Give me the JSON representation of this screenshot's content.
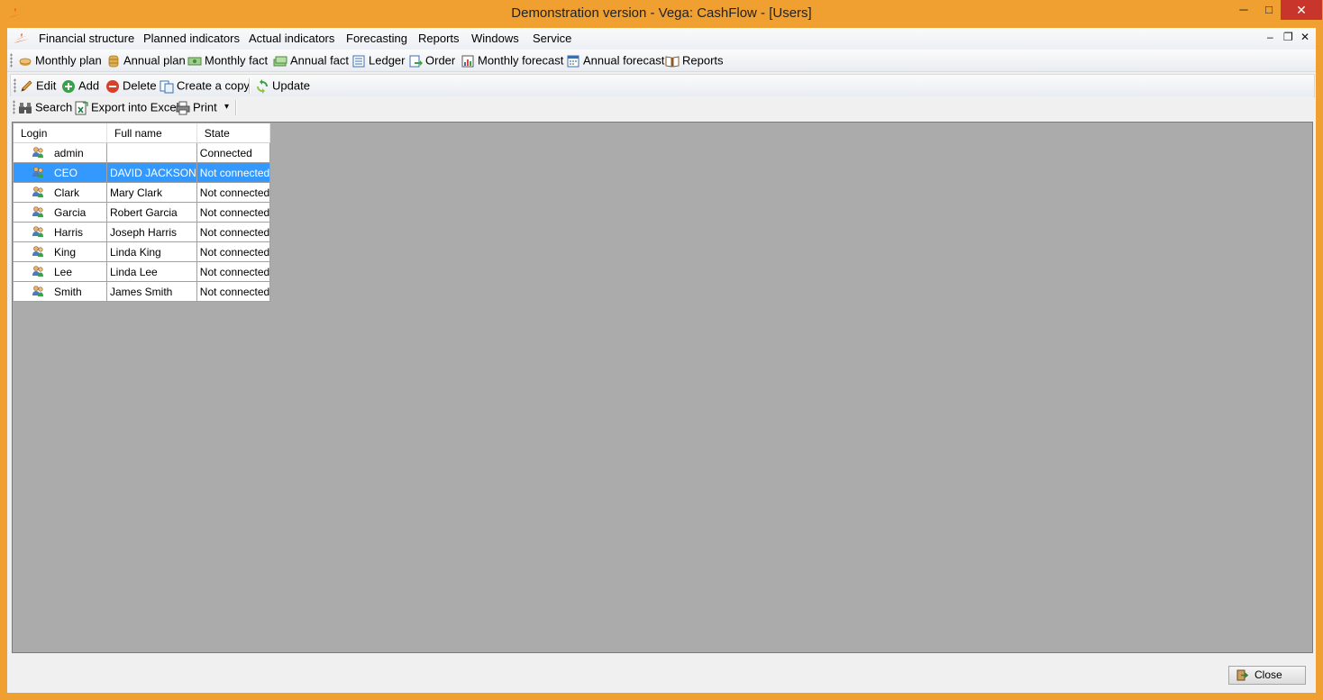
{
  "window": {
    "title": "Demonstration version - Vega: CashFlow - [Users]",
    "minimize": "─",
    "maximize": "□",
    "close": "✕"
  },
  "menu": {
    "items": [
      "Financial structure",
      "Planned indicators",
      "Actual indicators",
      "Forecasting",
      "Reports",
      "Windows",
      "Service"
    ],
    "mdi_minimize": "–",
    "mdi_restore": "❐",
    "mdi_close": "✕"
  },
  "nav_toolbar": {
    "items": [
      "Monthly plan",
      "Annual plan",
      "Monthly fact",
      "Annual fact",
      "Ledger",
      "Order",
      "Monthly forecast",
      "Annual forecast",
      "Reports"
    ]
  },
  "action_toolbar": {
    "edit": "Edit",
    "add": "Add",
    "delete": "Delete",
    "create_copy": "Create a copy",
    "update": "Update"
  },
  "tools_toolbar": {
    "search": "Search",
    "export": "Export into Excel",
    "print": "Print",
    "dropdown": "▾"
  },
  "table": {
    "columns": [
      "Login",
      "Full name",
      "State"
    ],
    "rows": [
      {
        "login": "admin",
        "full_name": "",
        "state": "Connected"
      },
      {
        "login": "CEO",
        "full_name": "DAVID JACKSON",
        "state": "Not connected"
      },
      {
        "login": "Clark",
        "full_name": "Mary Clark",
        "state": "Not connected"
      },
      {
        "login": "Garcia",
        "full_name": "Robert Garcia",
        "state": "Not connected"
      },
      {
        "login": "Harris",
        "full_name": "Joseph Harris",
        "state": "Not connected"
      },
      {
        "login": "King",
        "full_name": "Linda King",
        "state": "Not connected"
      },
      {
        "login": "Lee",
        "full_name": "Linda Lee",
        "state": "Not connected"
      },
      {
        "login": "Smith",
        "full_name": "James Smith",
        "state": "Not connected"
      }
    ],
    "selected_row": 1
  },
  "footer": {
    "close": "Close"
  },
  "colors": {
    "frame": "#f0a030",
    "selection": "#3399ff",
    "grid_background": "#ababab"
  }
}
